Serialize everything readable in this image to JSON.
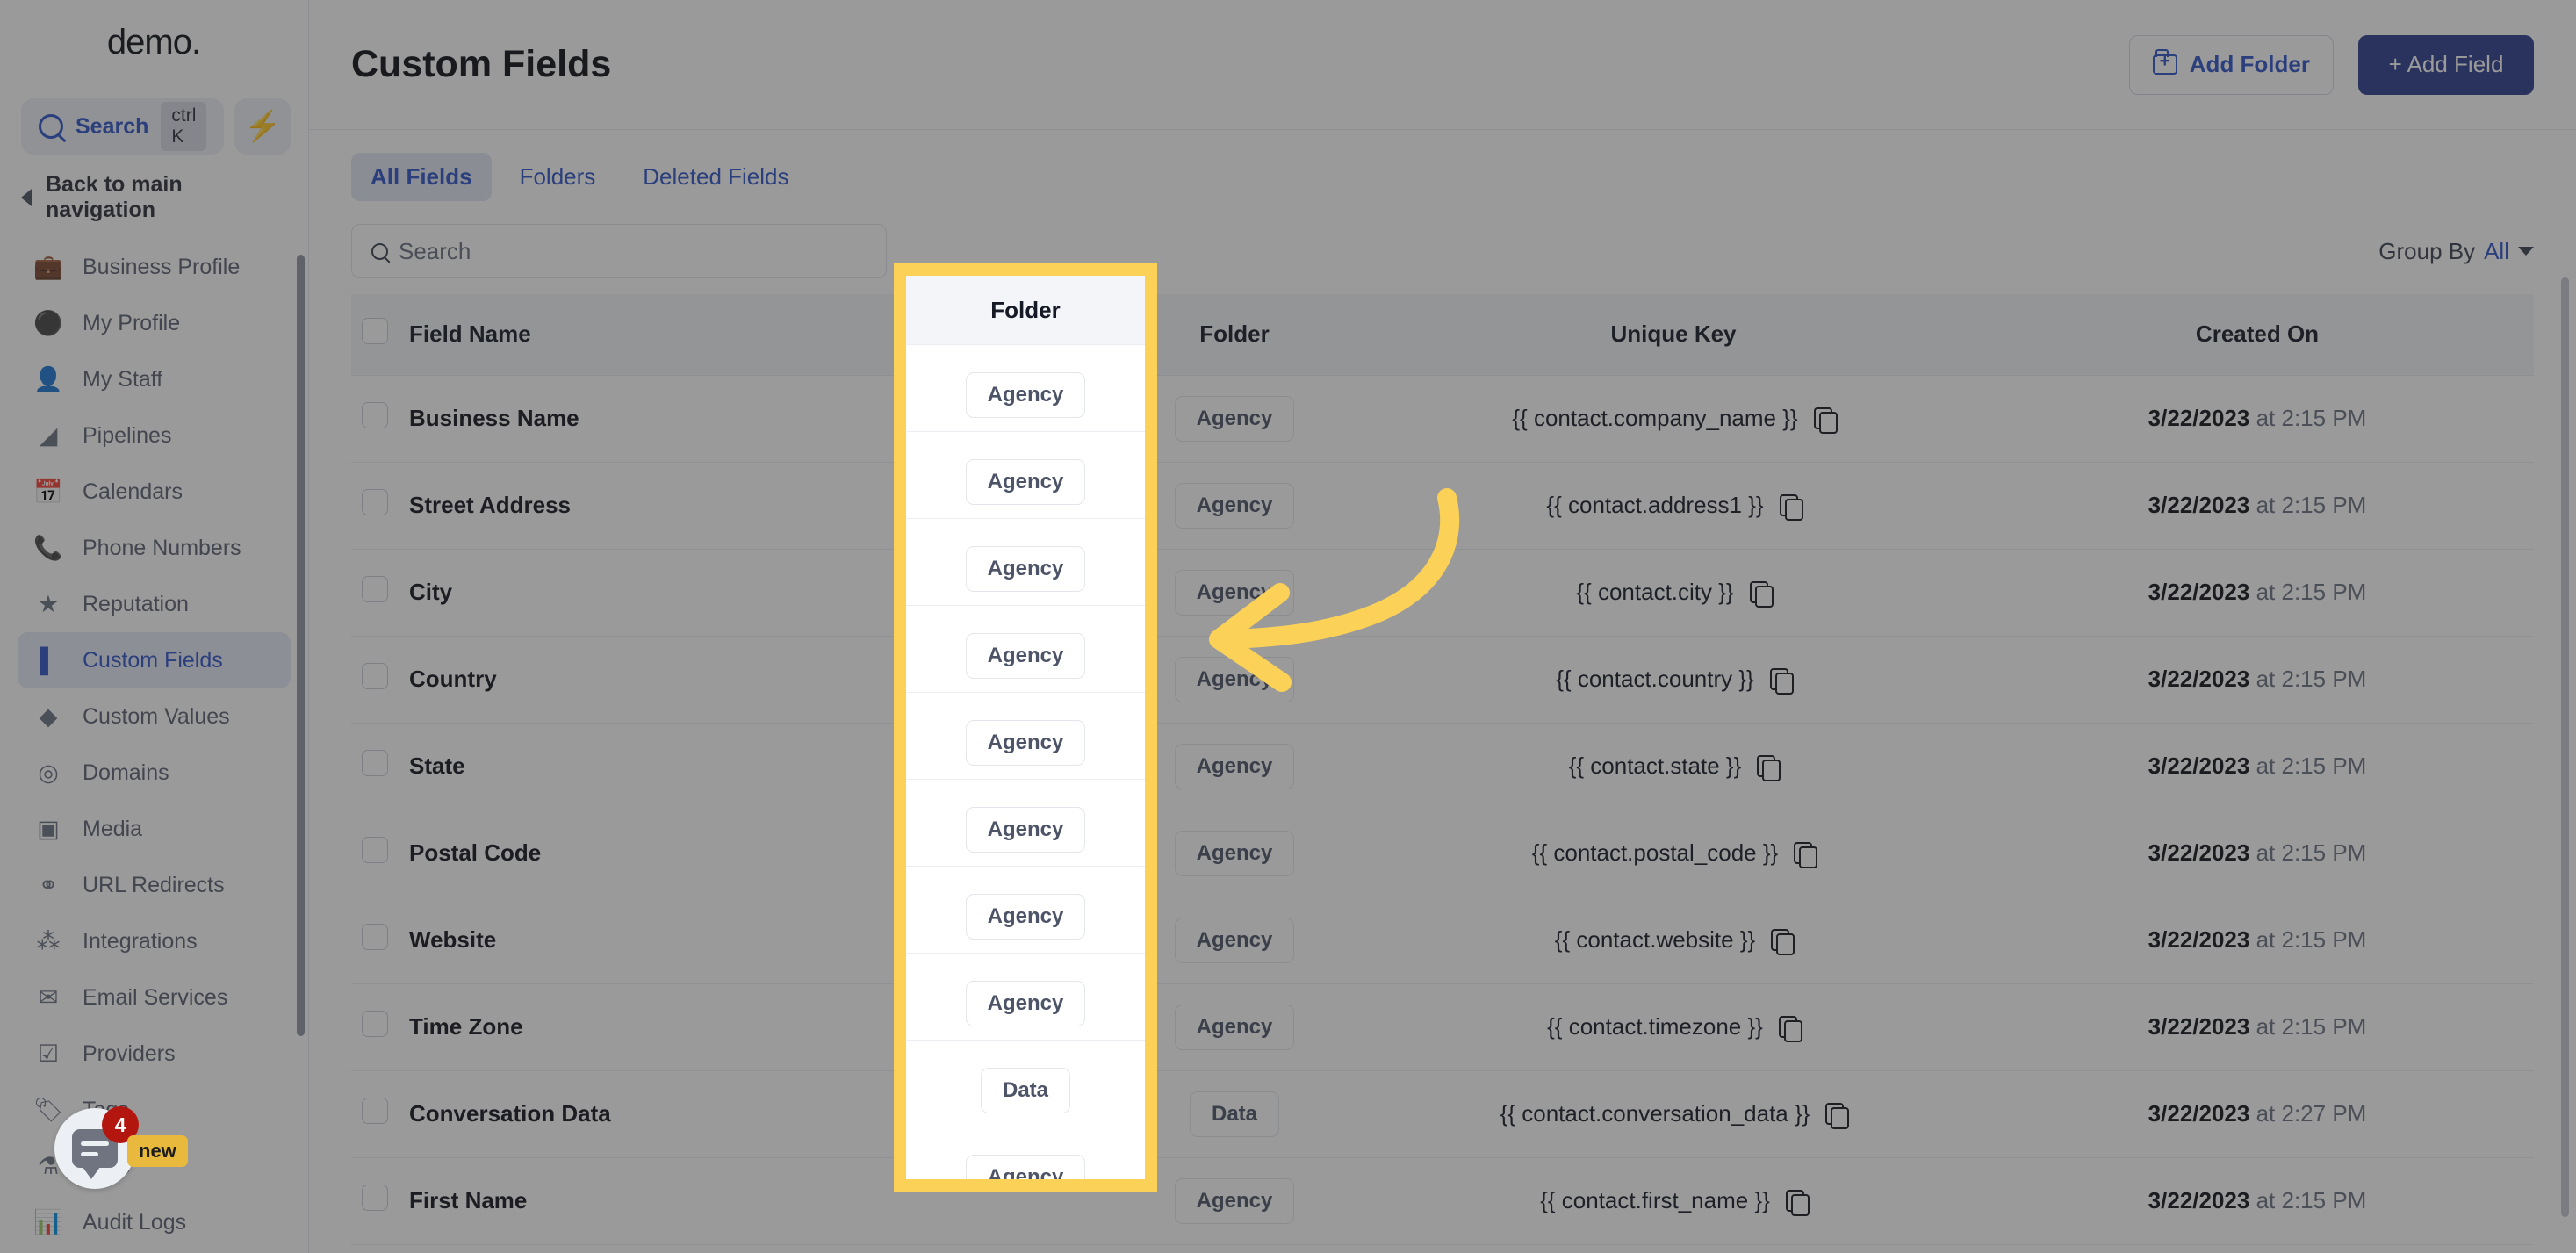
{
  "sidebar": {
    "brand": "demo",
    "brand_suffix": ".",
    "search": {
      "label": "Search",
      "shortcut": "ctrl K",
      "icon": "search-icon"
    },
    "quick_action_icon": "lightning-bolt-icon",
    "back_link": "Back to main navigation",
    "items": [
      {
        "label": "Business Profile",
        "icon": "briefcase-icon",
        "glyph": "💼",
        "active": false
      },
      {
        "label": "My Profile",
        "icon": "user-circle-icon",
        "glyph": "👤",
        "active": false
      },
      {
        "label": "My Staff",
        "icon": "person-icon",
        "glyph": "👤",
        "active": false
      },
      {
        "label": "Pipelines",
        "icon": "funnel-icon",
        "glyph": "ᴀ",
        "active": false
      },
      {
        "label": "Calendars",
        "icon": "calendar-icon",
        "glyph": "📅",
        "active": false
      },
      {
        "label": "Phone Numbers",
        "icon": "phone-icon",
        "glyph": "📞",
        "active": false
      },
      {
        "label": "Reputation",
        "icon": "star-icon",
        "glyph": "★",
        "active": false
      },
      {
        "label": "Custom Fields",
        "icon": "custom-fields-icon",
        "glyph": "▌",
        "active": true
      },
      {
        "label": "Custom Values",
        "icon": "shield-icon",
        "glyph": "◆",
        "active": false
      },
      {
        "label": "Domains",
        "icon": "globe-icon",
        "glyph": "◎",
        "active": false
      },
      {
        "label": "Media",
        "icon": "image-icon",
        "glyph": "▣",
        "active": false
      },
      {
        "label": "URL Redirects",
        "icon": "link-icon",
        "glyph": "⚭",
        "active": false
      },
      {
        "label": "Integrations",
        "icon": "puzzle-icon",
        "glyph": "⁂",
        "active": false
      },
      {
        "label": "Email Services",
        "icon": "envelope-icon",
        "glyph": "✉",
        "active": false
      },
      {
        "label": "Providers",
        "icon": "clipboard-check-icon",
        "glyph": "☑",
        "active": false
      },
      {
        "label": "Tags",
        "icon": "tag-icon",
        "glyph": "🏷",
        "active": false
      },
      {
        "label": "Labs",
        "icon": "flask-icon",
        "glyph": "⚗",
        "active": false
      },
      {
        "label": "Audit Logs",
        "icon": "bar-chart-icon",
        "glyph": "📊",
        "active": false
      }
    ],
    "chat_widget": {
      "icon": "chat-bubble-icon",
      "unread_count": "4",
      "new_badge": "new"
    }
  },
  "header": {
    "title": "Custom Fields",
    "add_folder_label": "Add Folder",
    "add_folder_icon": "folder-plus-icon",
    "add_field_label": "+ Add Field"
  },
  "tabs": [
    {
      "label": "All Fields",
      "active": true
    },
    {
      "label": "Folders",
      "active": false
    },
    {
      "label": "Deleted Fields",
      "active": false
    }
  ],
  "toolbar": {
    "search_placeholder": "Search",
    "search_value": "",
    "search_icon": "search-icon",
    "group_by_label": "Group By",
    "group_by_value": "All",
    "group_by_icon": "chevron-down-icon"
  },
  "table": {
    "columns": [
      "Field Name",
      "Folder",
      "Unique Key",
      "Created On"
    ],
    "rows": [
      {
        "field_name": "Business Name",
        "folder": "Agency",
        "unique_key": "{{ contact.company_name }}",
        "date": "3/22/2023",
        "time": "at 2:15 PM"
      },
      {
        "field_name": "Street Address",
        "folder": "Agency",
        "unique_key": "{{ contact.address1 }}",
        "date": "3/22/2023",
        "time": "at 2:15 PM"
      },
      {
        "field_name": "City",
        "folder": "Agency",
        "unique_key": "{{ contact.city }}",
        "date": "3/22/2023",
        "time": "at 2:15 PM"
      },
      {
        "field_name": "Country",
        "folder": "Agency",
        "unique_key": "{{ contact.country }}",
        "date": "3/22/2023",
        "time": "at 2:15 PM"
      },
      {
        "field_name": "State",
        "folder": "Agency",
        "unique_key": "{{ contact.state }}",
        "date": "3/22/2023",
        "time": "at 2:15 PM"
      },
      {
        "field_name": "Postal Code",
        "folder": "Agency",
        "unique_key": "{{ contact.postal_code }}",
        "date": "3/22/2023",
        "time": "at 2:15 PM"
      },
      {
        "field_name": "Website",
        "folder": "Agency",
        "unique_key": "{{ contact.website }}",
        "date": "3/22/2023",
        "time": "at 2:15 PM"
      },
      {
        "field_name": "Time Zone",
        "folder": "Agency",
        "unique_key": "{{ contact.timezone }}",
        "date": "3/22/2023",
        "time": "at 2:15 PM"
      },
      {
        "field_name": "Conversation Data",
        "folder": "Data",
        "unique_key": "{{ contact.conversation_data }}",
        "date": "3/22/2023",
        "time": "at 2:27 PM"
      },
      {
        "field_name": "First Name",
        "folder": "Agency",
        "unique_key": "{{ contact.first_name }}",
        "date": "3/22/2023",
        "time": "at 2:15 PM"
      }
    ]
  },
  "annotation": {
    "highlight_color": "#FBD157",
    "highlight_target": "Folder column",
    "arrow_icon": "curved-left-arrow-icon"
  }
}
